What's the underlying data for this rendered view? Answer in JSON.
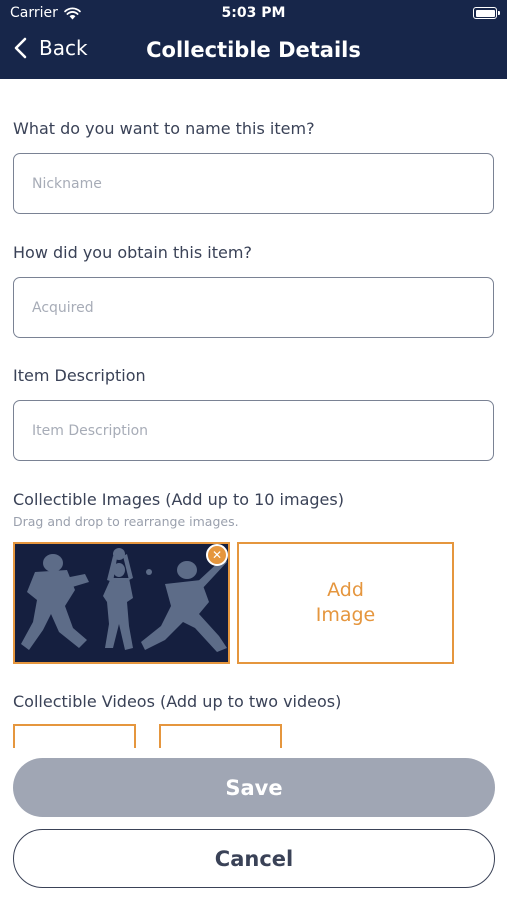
{
  "status_bar": {
    "carrier": "Carrier",
    "time": "5:03 PM",
    "wifi_icon": "wifi-icon",
    "battery_icon": "battery-icon"
  },
  "nav": {
    "back_label": "Back",
    "back_icon": "chevron-left-icon",
    "title": "Collectible Details"
  },
  "form": {
    "name": {
      "label": "What do you want to name this item?",
      "placeholder": "Nickname",
      "value": ""
    },
    "obtained": {
      "label": "How did you obtain this item?",
      "placeholder": "Acquired",
      "value": ""
    },
    "description": {
      "label": "Item Description",
      "placeholder": "Item Description",
      "value": ""
    },
    "images": {
      "label": "Collectible Images (Add up to 10 images)",
      "hint": "Drag and drop to rearrange images.",
      "items": [
        {
          "name": "sports-silhouettes-image",
          "remove_icon": "close-circle-icon"
        }
      ],
      "add_label": "Add Image"
    },
    "videos": {
      "label": "Collectible Videos (Add up to two videos)"
    }
  },
  "actions": {
    "save_label": "Save",
    "cancel_label": "Cancel"
  },
  "colors": {
    "nav_background": "#17264a",
    "accent": "#e5963e",
    "save_background": "#a0a6b4",
    "text": "#3a4257"
  }
}
